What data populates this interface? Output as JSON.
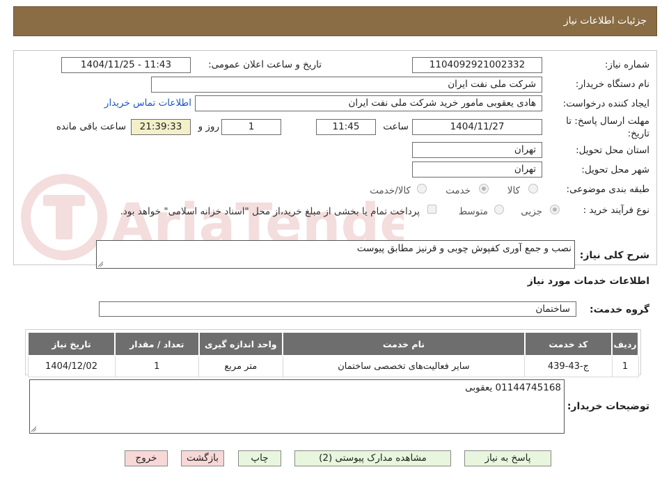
{
  "header": {
    "title": "جزئیات اطلاعات نیاز"
  },
  "form": {
    "need_number": {
      "label": "شماره نیاز:",
      "value": "1104092921002332"
    },
    "announce_datetime": {
      "label": "تاریخ و ساعت اعلان عمومی:",
      "value": "1404/11/25 - 11:43"
    },
    "buyer_org": {
      "label": "نام دستگاه خریدار:",
      "value": "شرکت ملی نفت ایران"
    },
    "requester": {
      "label": "ایجاد کننده درخواست:",
      "value": "هادی یعقوبی مامور خرید  شرکت ملی نفت ایران"
    },
    "buyer_contact_link": "اطلاعات تماس خریدار",
    "deadline": {
      "label_line1": "مهلت ارسال پاسخ: تا",
      "label_line2": "تاریخ:",
      "date": "1404/11/27",
      "time_label": "ساعت",
      "time": "11:45",
      "days": "1",
      "days_label": "روز و",
      "remaining": "21:39:33",
      "remaining_label": "ساعت باقی مانده"
    },
    "province": {
      "label": "استان محل تحویل:",
      "value": "تهران"
    },
    "city": {
      "label": "شهر محل تحویل:",
      "value": "تهران"
    },
    "category": {
      "label": "طبقه بندی موضوعی:",
      "options": [
        "کالا",
        "خدمت",
        "کالا/خدمت"
      ],
      "selected": "خدمت"
    },
    "purchase_type": {
      "label": "نوع فرآیند خرید :",
      "options": [
        "جزیی",
        "متوسط"
      ],
      "selected": "جزیی",
      "note": "پرداخت تمام یا بخشی از مبلغ خرید،از محل \"اسناد خزانه اسلامی\" خواهد بود."
    }
  },
  "description": {
    "label": "شرح کلی نیاز:",
    "value": "نصب و جمع آوری کفپوش چوبی و قرنیز مطابق پیوست"
  },
  "services_section_title": "اطلاعات خدمات مورد نیاز",
  "service_group": {
    "label": "گروه خدمت:",
    "value": "ساختمان"
  },
  "table": {
    "columns": [
      "ردیف",
      "کد خدمت",
      "نام خدمت",
      "واحد اندازه گیری",
      "تعداد / مقدار",
      "تاریخ نیاز"
    ],
    "rows": [
      [
        "1",
        "ج-43-439",
        "سایر فعالیت‌های تخصصی ساختمان",
        "متر مربع",
        "1",
        "1404/12/02"
      ]
    ]
  },
  "buyer_notes": {
    "label": "توضیحات خریدار:",
    "value": "01144745168 یعقوبی"
  },
  "buttons": {
    "reply": "پاسخ به نیاز",
    "attachments": "مشاهده مدارک پیوستی (2)",
    "print": "چاپ",
    "back": "بازگشت",
    "exit": "خروج"
  },
  "watermark_text": "AriaTender.neT",
  "colors": {
    "header_bg": "#8a6d45",
    "table_header": "#6e6e6e",
    "timer_bg": "#f3f0c9",
    "link": "#1a57c6"
  }
}
